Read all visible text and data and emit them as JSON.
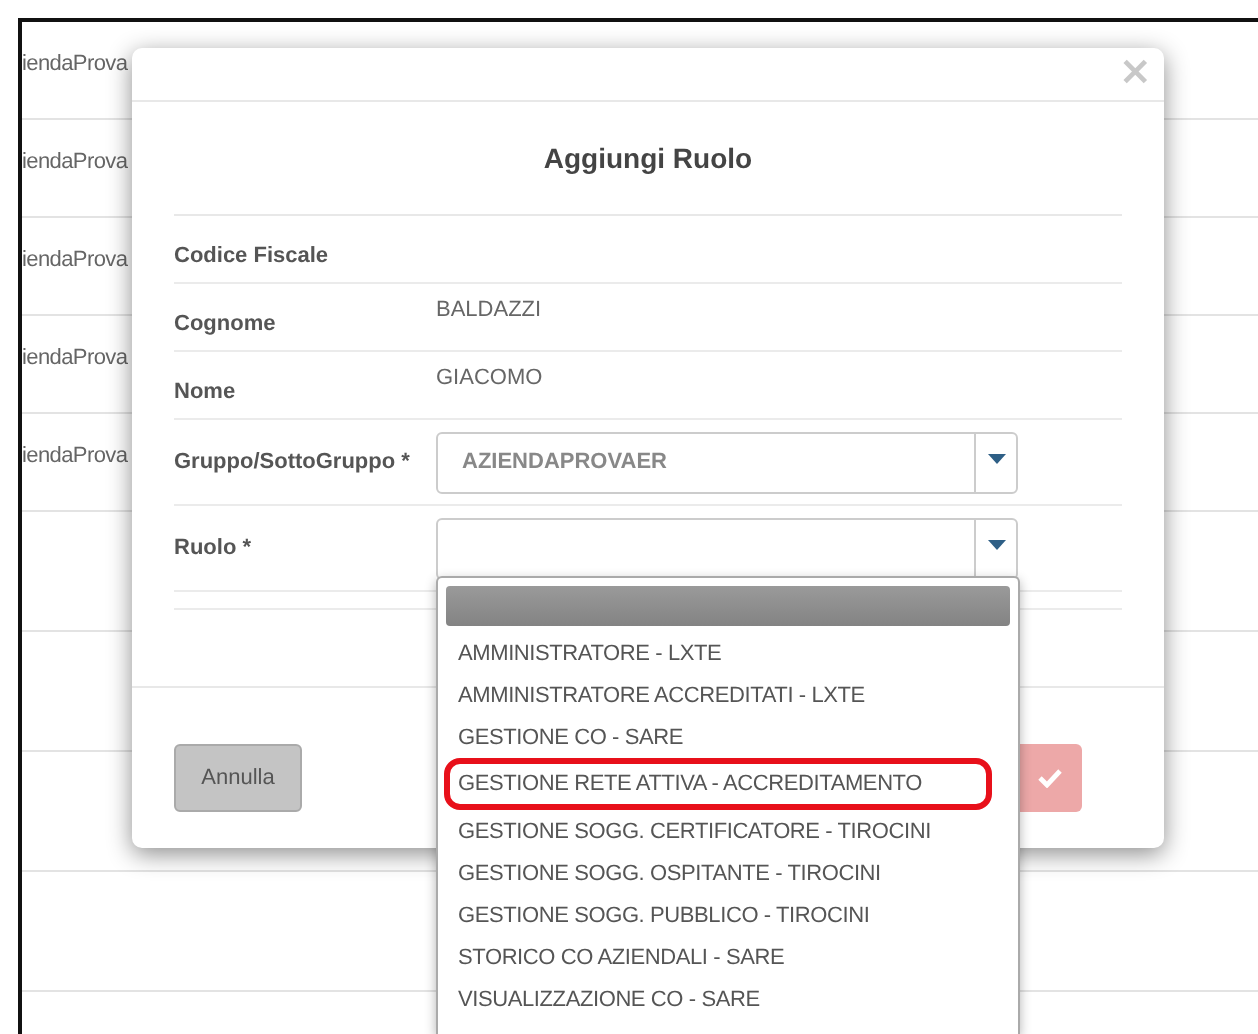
{
  "background_rows": [
    {
      "text": "iendaProva"
    },
    {
      "text": "iendaProva"
    },
    {
      "text": "iendaProva"
    },
    {
      "text": "iendaProva"
    },
    {
      "text": "iendaProva"
    }
  ],
  "modal": {
    "close": "×",
    "title": "Aggiungi Ruolo",
    "fields": [
      {
        "kind": "text",
        "label": "Codice Fiscale"
      },
      {
        "kind": "text",
        "label": "Cognome",
        "value": "BALDAZZI"
      },
      {
        "kind": "text",
        "label": "Nome",
        "value": "GIACOMO"
      },
      {
        "kind": "select",
        "label": "Gruppo/SottoGruppo *",
        "value": "AZIENDAPROVAER"
      },
      {
        "kind": "select",
        "label": "Ruolo *"
      }
    ],
    "buttons": [
      {
        "kind": "cancel",
        "label": "Annulla"
      },
      {
        "kind": "confirm"
      }
    ]
  },
  "dropdown": {
    "options": [
      {
        "selected": true,
        "highlighted": false
      },
      {
        "label": "AMMINISTRATORE - LXTE",
        "selected": false,
        "highlighted": false
      },
      {
        "label": "AMMINISTRATORE ACCREDITATI - LXTE",
        "selected": false,
        "highlighted": false
      },
      {
        "label": "GESTIONE CO - SARE",
        "selected": false,
        "highlighted": false
      },
      {
        "label": "GESTIONE RETE ATTIVA - ACCREDITAMENTO",
        "selected": false,
        "highlighted": true
      },
      {
        "label": "GESTIONE SOGG. CERTIFICATORE - TIROCINI",
        "selected": false,
        "highlighted": false
      },
      {
        "label": "GESTIONE SOGG. OSPITANTE - TIROCINI",
        "selected": false,
        "highlighted": false
      },
      {
        "label": "GESTIONE SOGG. PUBBLICO - TIROCINI",
        "selected": false,
        "highlighted": false
      },
      {
        "label": "STORICO CO AZIENDALI - SARE",
        "selected": false,
        "highlighted": false
      },
      {
        "label": "VISUALIZZAZIONE CO - SARE",
        "selected": false,
        "highlighted": false
      }
    ]
  }
}
